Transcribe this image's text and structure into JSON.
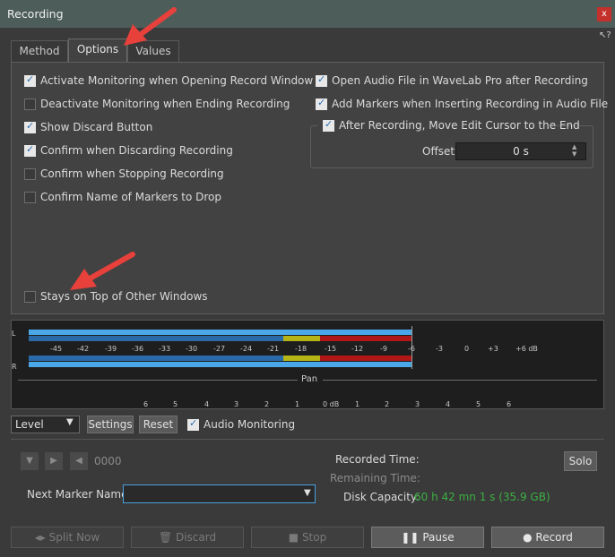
{
  "window": {
    "title": "Recording",
    "close": "x",
    "help": "?"
  },
  "tabs": [
    {
      "label": "Method"
    },
    {
      "label": "Options"
    },
    {
      "label": "Values"
    }
  ],
  "options_left": [
    {
      "label": "Activate Monitoring when Opening Record Window",
      "checked": true
    },
    {
      "label": "Deactivate Monitoring when Ending Recording",
      "checked": false
    },
    {
      "label": "Show Discard Button",
      "checked": true
    },
    {
      "label": "Confirm when Discarding Recording",
      "checked": true
    },
    {
      "label": "Confirm when Stopping Recording",
      "checked": false
    },
    {
      "label": "Confirm Name of Markers to Drop",
      "checked": false
    }
  ],
  "options_right": [
    {
      "label": "Open Audio File in WaveLab Pro after Recording",
      "checked": true
    },
    {
      "label": "Add Markers when Inserting Recording in Audio File",
      "checked": true
    }
  ],
  "after_recording": {
    "label": "After Recording, Move Edit Cursor to the End",
    "checked": true
  },
  "offset": {
    "label": "Offset",
    "value": "0 s"
  },
  "stays_on_top": {
    "label": "Stays on Top of Other Windows",
    "checked": false
  },
  "meter": {
    "channel_left": "L",
    "channel_right": "R",
    "scale": [
      "-45",
      "-42",
      "-39",
      "-36",
      "-33",
      "-30",
      "-27",
      "-24",
      "-21",
      "-18",
      "-15",
      "-12",
      "-9",
      "-6",
      "-3",
      "0",
      "+3",
      "+6 dB"
    ],
    "pan_label": "Pan",
    "pan_scale": [
      "6",
      "5",
      "4",
      "3",
      "2",
      "1",
      "0 dB",
      "1",
      "2",
      "3",
      "4",
      "5",
      "6"
    ],
    "colors": {
      "blue": "#4aa8e8",
      "yellow": "#b5b515",
      "red": "#b01818"
    }
  },
  "controls": {
    "level_select": "Level",
    "settings": "Settings",
    "reset": "Reset",
    "audio_monitoring": "Audio Monitoring",
    "audio_monitoring_checked": true
  },
  "transport": {
    "position": "0000"
  },
  "marker": {
    "label": "Next Marker Name",
    "value": ""
  },
  "info": {
    "recorded_time_label": "Recorded Time:",
    "remaining_time_label": "Remaining Time:",
    "disk_capacity_label": "Disk Capacity:",
    "disk_capacity_value": "60 h 42 mn 1 s (35.9 GB)",
    "disk_color": "#3cb043"
  },
  "solo": "Solo",
  "bottom_buttons": {
    "split_now": "Split Now",
    "discard": "Discard",
    "stop": "Stop",
    "pause": "Pause",
    "record": "Record"
  }
}
